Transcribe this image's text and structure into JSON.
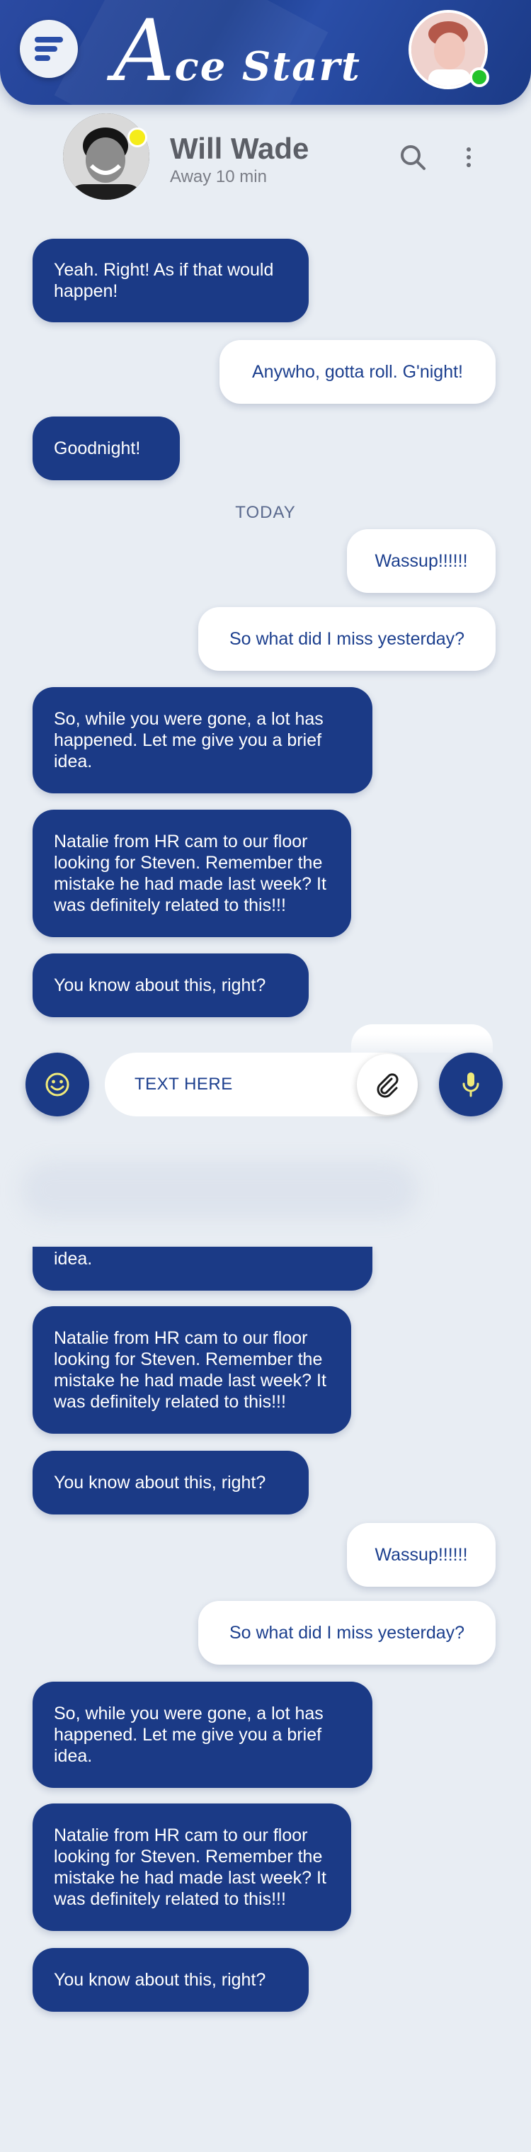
{
  "header": {
    "app_title_initial": "A",
    "app_title_rest": "ce Start",
    "menu_icon": "menu-icon",
    "user_status_color": "#23c32b",
    "accent": "#1b3a86"
  },
  "contact": {
    "name": "Will Wade",
    "status": "Away 10 min",
    "status_color": "#f5ec1a"
  },
  "divider": {
    "label": "TODAY"
  },
  "messages": [
    {
      "dir": "in",
      "text": "Yeah. Right! As if that would happen!"
    },
    {
      "dir": "out",
      "text": "Anywho, gotta roll. G'night!"
    },
    {
      "dir": "in",
      "text": "Goodnight!"
    },
    {
      "dir": "out",
      "text": "Wassup!!!!!!"
    },
    {
      "dir": "out",
      "text": "So what did I miss yesterday?"
    },
    {
      "dir": "in",
      "text": "So, while you were gone, a lot has happened. Let me give you a brief idea."
    },
    {
      "dir": "in",
      "text": "Natalie from HR cam to our floor looking for Steven. Remember the mistake he had made last week? It was definitely related to this!!!"
    },
    {
      "dir": "in",
      "text": "You know about this, right?"
    },
    {
      "dir": "in",
      "text": "idea."
    },
    {
      "dir": "in",
      "text": "Natalie from HR cam to our floor looking for Steven. Remember the mistake he had made last week? It was definitely related to this!!!"
    },
    {
      "dir": "in",
      "text": "You know about this, right?"
    },
    {
      "dir": "out",
      "text": "Wassup!!!!!!"
    },
    {
      "dir": "out",
      "text": "So what did I miss yesterday?"
    },
    {
      "dir": "in",
      "text": "So, while you were gone, a lot has happened. Let me give you a brief idea."
    },
    {
      "dir": "in",
      "text": "Natalie from HR cam to our floor looking for Steven. Remember the mistake he had made last week? It was definitely related to this!!!"
    },
    {
      "dir": "in",
      "text": "You know about this, right?"
    }
  ],
  "composer": {
    "placeholder": "TEXT HERE",
    "emoji_icon": "smiley-icon",
    "attach_icon": "paperclip-icon",
    "mic_icon": "microphone-icon"
  }
}
